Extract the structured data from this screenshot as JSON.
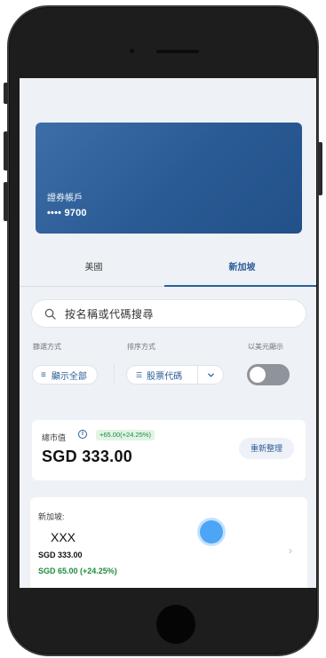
{
  "account": {
    "label": "證券帳戶",
    "number": "•••• 9700"
  },
  "tabs": [
    {
      "label": "美國",
      "active": false
    },
    {
      "label": "新加坡",
      "active": true
    }
  ],
  "search": {
    "placeholder": "按名稱或代碼搜尋"
  },
  "controls": {
    "filter_label": "篩選方式",
    "sort_label": "排序方式",
    "usd_label": "以美元顯示",
    "filter_value": "顯示全部",
    "sort_value": "股票代碼",
    "usd_toggle_on": false
  },
  "summary": {
    "market_value_label": "總市值",
    "change": "+65.00(+24.25%)",
    "total": "SGD 333.00",
    "refresh_label": "重新整理"
  },
  "holding": {
    "region": "新加坡:",
    "name": "XXX",
    "value": "SGD 333.00",
    "profit_loss": "SGD 65.00 (+24.25%)"
  },
  "colors": {
    "accent": "#2c5e97",
    "card": "#2a5a93",
    "positive": "#1e8a3d",
    "background": "#eef1f6"
  },
  "icons": {
    "search": "search-icon",
    "filter": "filter-icon",
    "sort": "sort-icon",
    "dropdown": "chevron-down-icon",
    "info": "info-icon",
    "row": "chevron-right-icon"
  }
}
